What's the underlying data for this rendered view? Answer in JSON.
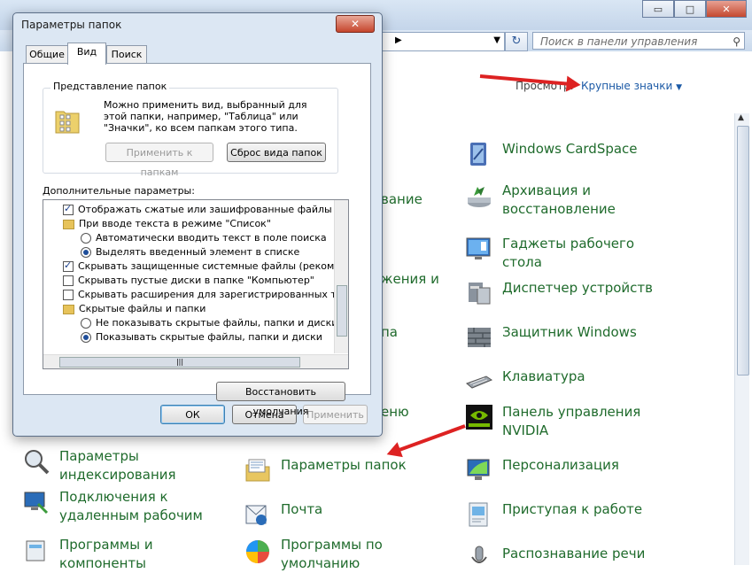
{
  "background_window": {
    "search_placeholder": "Поиск в панели управления",
    "view_label": "Просмотр:",
    "view_value": "Крупные значки",
    "window_controls": {
      "minimize": "▭",
      "maximize": "□",
      "close": "✕"
    },
    "items": [
      {
        "label": "Windows CardSpace",
        "icon": "cardspace-icon"
      },
      {
        "label": "Архивация и восстановление",
        "icon": "backup-icon"
      },
      {
        "label": "Гаджеты рабочего стола",
        "icon": "gadgets-icon"
      },
      {
        "label": "Диспетчер устройств",
        "icon": "device-manager-icon"
      },
      {
        "label": "Защитник Windows",
        "icon": "defender-icon"
      },
      {
        "label": "Клавиатура",
        "icon": "keyboard-icon"
      },
      {
        "label": "Панель управления NVIDIA",
        "icon": "nvidia-icon"
      },
      {
        "label": "Параметры индексирования",
        "icon": "indexing-icon"
      },
      {
        "label": "Параметры папок",
        "icon": "folder-options-icon"
      },
      {
        "label": "Персонализация",
        "icon": "personalization-icon"
      },
      {
        "label": "Подключения к удаленным рабочим",
        "icon": "remote-desktop-icon"
      },
      {
        "label": "Почта",
        "icon": "mail-icon"
      },
      {
        "label": "Приступая к работе",
        "icon": "getting-started-icon"
      },
      {
        "label": "Программы и компоненты",
        "icon": "programs-icon"
      },
      {
        "label": "Программы по умолчанию",
        "icon": "default-programs-icon"
      },
      {
        "label": "Распознавание речи",
        "icon": "speech-icon"
      }
    ],
    "partial_labels": [
      "вание",
      "жения и",
      "па",
      "еню"
    ]
  },
  "dialog": {
    "title": "Параметры папок",
    "close": "✕",
    "tabs": [
      "Общие",
      "Вид",
      "Поиск"
    ],
    "active_tab": "Вид",
    "folder_view_group": {
      "title": "Представление папок",
      "text": "Можно применить вид, выбранный для этой папки, например, \"Таблица\" или \"Значки\", ко всем папкам этого типа.",
      "apply_button": "Применить к папкам",
      "reset_button": "Сброс вида папок"
    },
    "advanced_label": "Дополнительные параметры:",
    "tree": [
      {
        "type": "checkbox",
        "checked": true,
        "text": "Отображать сжатые или зашифрованные файлы NTFS"
      },
      {
        "type": "folder",
        "text": "При вводе текста в режиме \"Список\""
      },
      {
        "type": "radio",
        "checked": false,
        "text": "Автоматически вводить текст в поле поиска"
      },
      {
        "type": "radio",
        "checked": true,
        "text": "Выделять введенный элемент в списке"
      },
      {
        "type": "checkbox",
        "checked": true,
        "text": "Скрывать защищенные системные файлы (рекоменд"
      },
      {
        "type": "checkbox",
        "checked": false,
        "text": "Скрывать пустые диски в папке \"Компьютер\""
      },
      {
        "type": "checkbox",
        "checked": false,
        "text": "Скрывать расширения для зарегистрированных типов"
      },
      {
        "type": "folder",
        "text": "Скрытые файлы и папки"
      },
      {
        "type": "radio",
        "checked": false,
        "text": "Не показывать скрытые файлы, папки и диски"
      },
      {
        "type": "radio",
        "checked": true,
        "text": "Показывать скрытые файлы, папки и диски"
      }
    ],
    "scroll_grip": "|||",
    "restore_defaults": "Восстановить умолчания",
    "ok": "ОК",
    "cancel": "Отмена",
    "apply": "Применить"
  },
  "colors": {
    "annotation_arrow": "#dd2222",
    "link_green": "#1f6b2c",
    "link_blue": "#1c5aa6"
  }
}
